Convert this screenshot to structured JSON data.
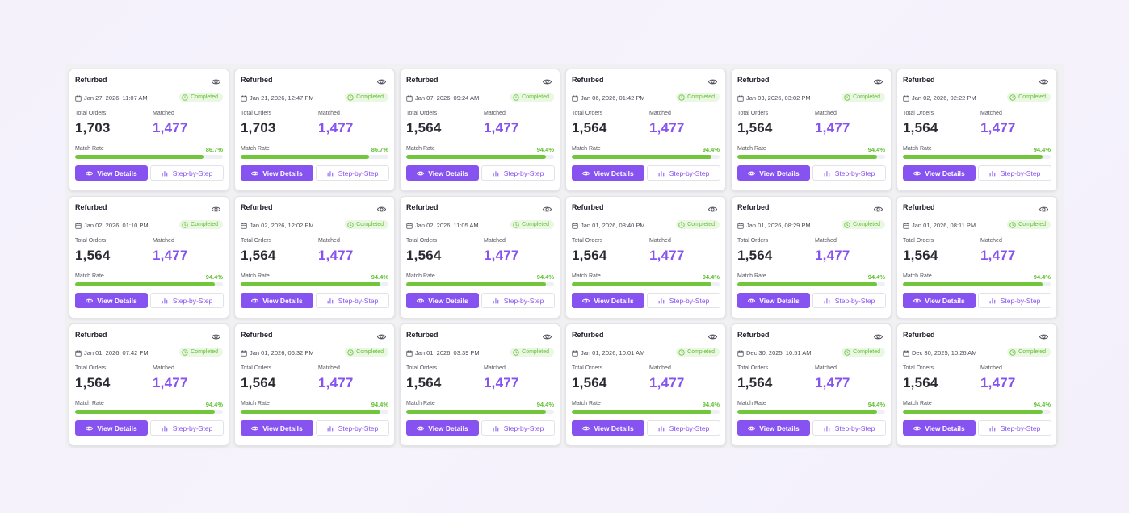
{
  "labels": {
    "total_orders": "Total Orders",
    "matched": "Matched",
    "match_rate": "Match Rate",
    "view_details": "View Details",
    "step_by_step": "Step-by-Step"
  },
  "colors": {
    "accent": "#8653f0",
    "success": "#5fbf2f",
    "progress": "#72c63c",
    "badge_bg": "#eaf7e2"
  },
  "icons": {
    "view": "eye-icon",
    "date": "calendar-icon",
    "status": "check-circle-icon",
    "step": "bar-chart-icon"
  },
  "cards": [
    {
      "title": "Refurbed",
      "date": "Jan 27, 2026, 11:07 AM",
      "status": "Completed",
      "total_orders": "1,703",
      "matched": "1,477",
      "match_rate": "86.7%",
      "match_rate_value": 86.7
    },
    {
      "title": "Refurbed",
      "date": "Jan 21, 2026, 12:47 PM",
      "status": "Completed",
      "total_orders": "1,703",
      "matched": "1,477",
      "match_rate": "86.7%",
      "match_rate_value": 86.7
    },
    {
      "title": "Refurbed",
      "date": "Jan 07, 2026, 09:24 AM",
      "status": "Completed",
      "total_orders": "1,564",
      "matched": "1,477",
      "match_rate": "94.4%",
      "match_rate_value": 94.4
    },
    {
      "title": "Refurbed",
      "date": "Jan 06, 2026, 01:42 PM",
      "status": "Completed",
      "total_orders": "1,564",
      "matched": "1,477",
      "match_rate": "94.4%",
      "match_rate_value": 94.4
    },
    {
      "title": "Refurbed",
      "date": "Jan 03, 2026, 03:02 PM",
      "status": "Completed",
      "total_orders": "1,564",
      "matched": "1,477",
      "match_rate": "94.4%",
      "match_rate_value": 94.4
    },
    {
      "title": "Refurbed",
      "date": "Jan 02, 2026, 02:22 PM",
      "status": "Completed",
      "total_orders": "1,564",
      "matched": "1,477",
      "match_rate": "94.4%",
      "match_rate_value": 94.4
    },
    {
      "title": "Refurbed",
      "date": "Jan 02, 2026, 01:10 PM",
      "status": "Completed",
      "total_orders": "1,564",
      "matched": "1,477",
      "match_rate": "94.4%",
      "match_rate_value": 94.4
    },
    {
      "title": "Refurbed",
      "date": "Jan 02, 2026, 12:02 PM",
      "status": "Completed",
      "total_orders": "1,564",
      "matched": "1,477",
      "match_rate": "94.4%",
      "match_rate_value": 94.4
    },
    {
      "title": "Refurbed",
      "date": "Jan 02, 2026, 11:05 AM",
      "status": "Completed",
      "total_orders": "1,564",
      "matched": "1,477",
      "match_rate": "94.4%",
      "match_rate_value": 94.4
    },
    {
      "title": "Refurbed",
      "date": "Jan 01, 2026, 08:40 PM",
      "status": "Completed",
      "total_orders": "1,564",
      "matched": "1,477",
      "match_rate": "94.4%",
      "match_rate_value": 94.4
    },
    {
      "title": "Refurbed",
      "date": "Jan 01, 2026, 08:29 PM",
      "status": "Completed",
      "total_orders": "1,564",
      "matched": "1,477",
      "match_rate": "94.4%",
      "match_rate_value": 94.4
    },
    {
      "title": "Refurbed",
      "date": "Jan 01, 2026, 08:11 PM",
      "status": "Completed",
      "total_orders": "1,564",
      "matched": "1,477",
      "match_rate": "94.4%",
      "match_rate_value": 94.4
    },
    {
      "title": "Refurbed",
      "date": "Jan 01, 2026, 07:42 PM",
      "status": "Completed",
      "total_orders": "1,564",
      "matched": "1,477",
      "match_rate": "94.4%",
      "match_rate_value": 94.4
    },
    {
      "title": "Refurbed",
      "date": "Jan 01, 2026, 06:32 PM",
      "status": "Completed",
      "total_orders": "1,564",
      "matched": "1,477",
      "match_rate": "94.4%",
      "match_rate_value": 94.4
    },
    {
      "title": "Refurbed",
      "date": "Jan 01, 2026, 03:39 PM",
      "status": "Completed",
      "total_orders": "1,564",
      "matched": "1,477",
      "match_rate": "94.4%",
      "match_rate_value": 94.4
    },
    {
      "title": "Refurbed",
      "date": "Jan 01, 2026, 10:01 AM",
      "status": "Completed",
      "total_orders": "1,564",
      "matched": "1,477",
      "match_rate": "94.4%",
      "match_rate_value": 94.4
    },
    {
      "title": "Refurbed",
      "date": "Dec 30, 2025, 10:51 AM",
      "status": "Completed",
      "total_orders": "1,564",
      "matched": "1,477",
      "match_rate": "94.4%",
      "match_rate_value": 94.4
    },
    {
      "title": "Refurbed",
      "date": "Dec 30, 2025, 10:26 AM",
      "status": "Completed",
      "total_orders": "1,564",
      "matched": "1,477",
      "match_rate": "94.4%",
      "match_rate_value": 94.4
    }
  ]
}
